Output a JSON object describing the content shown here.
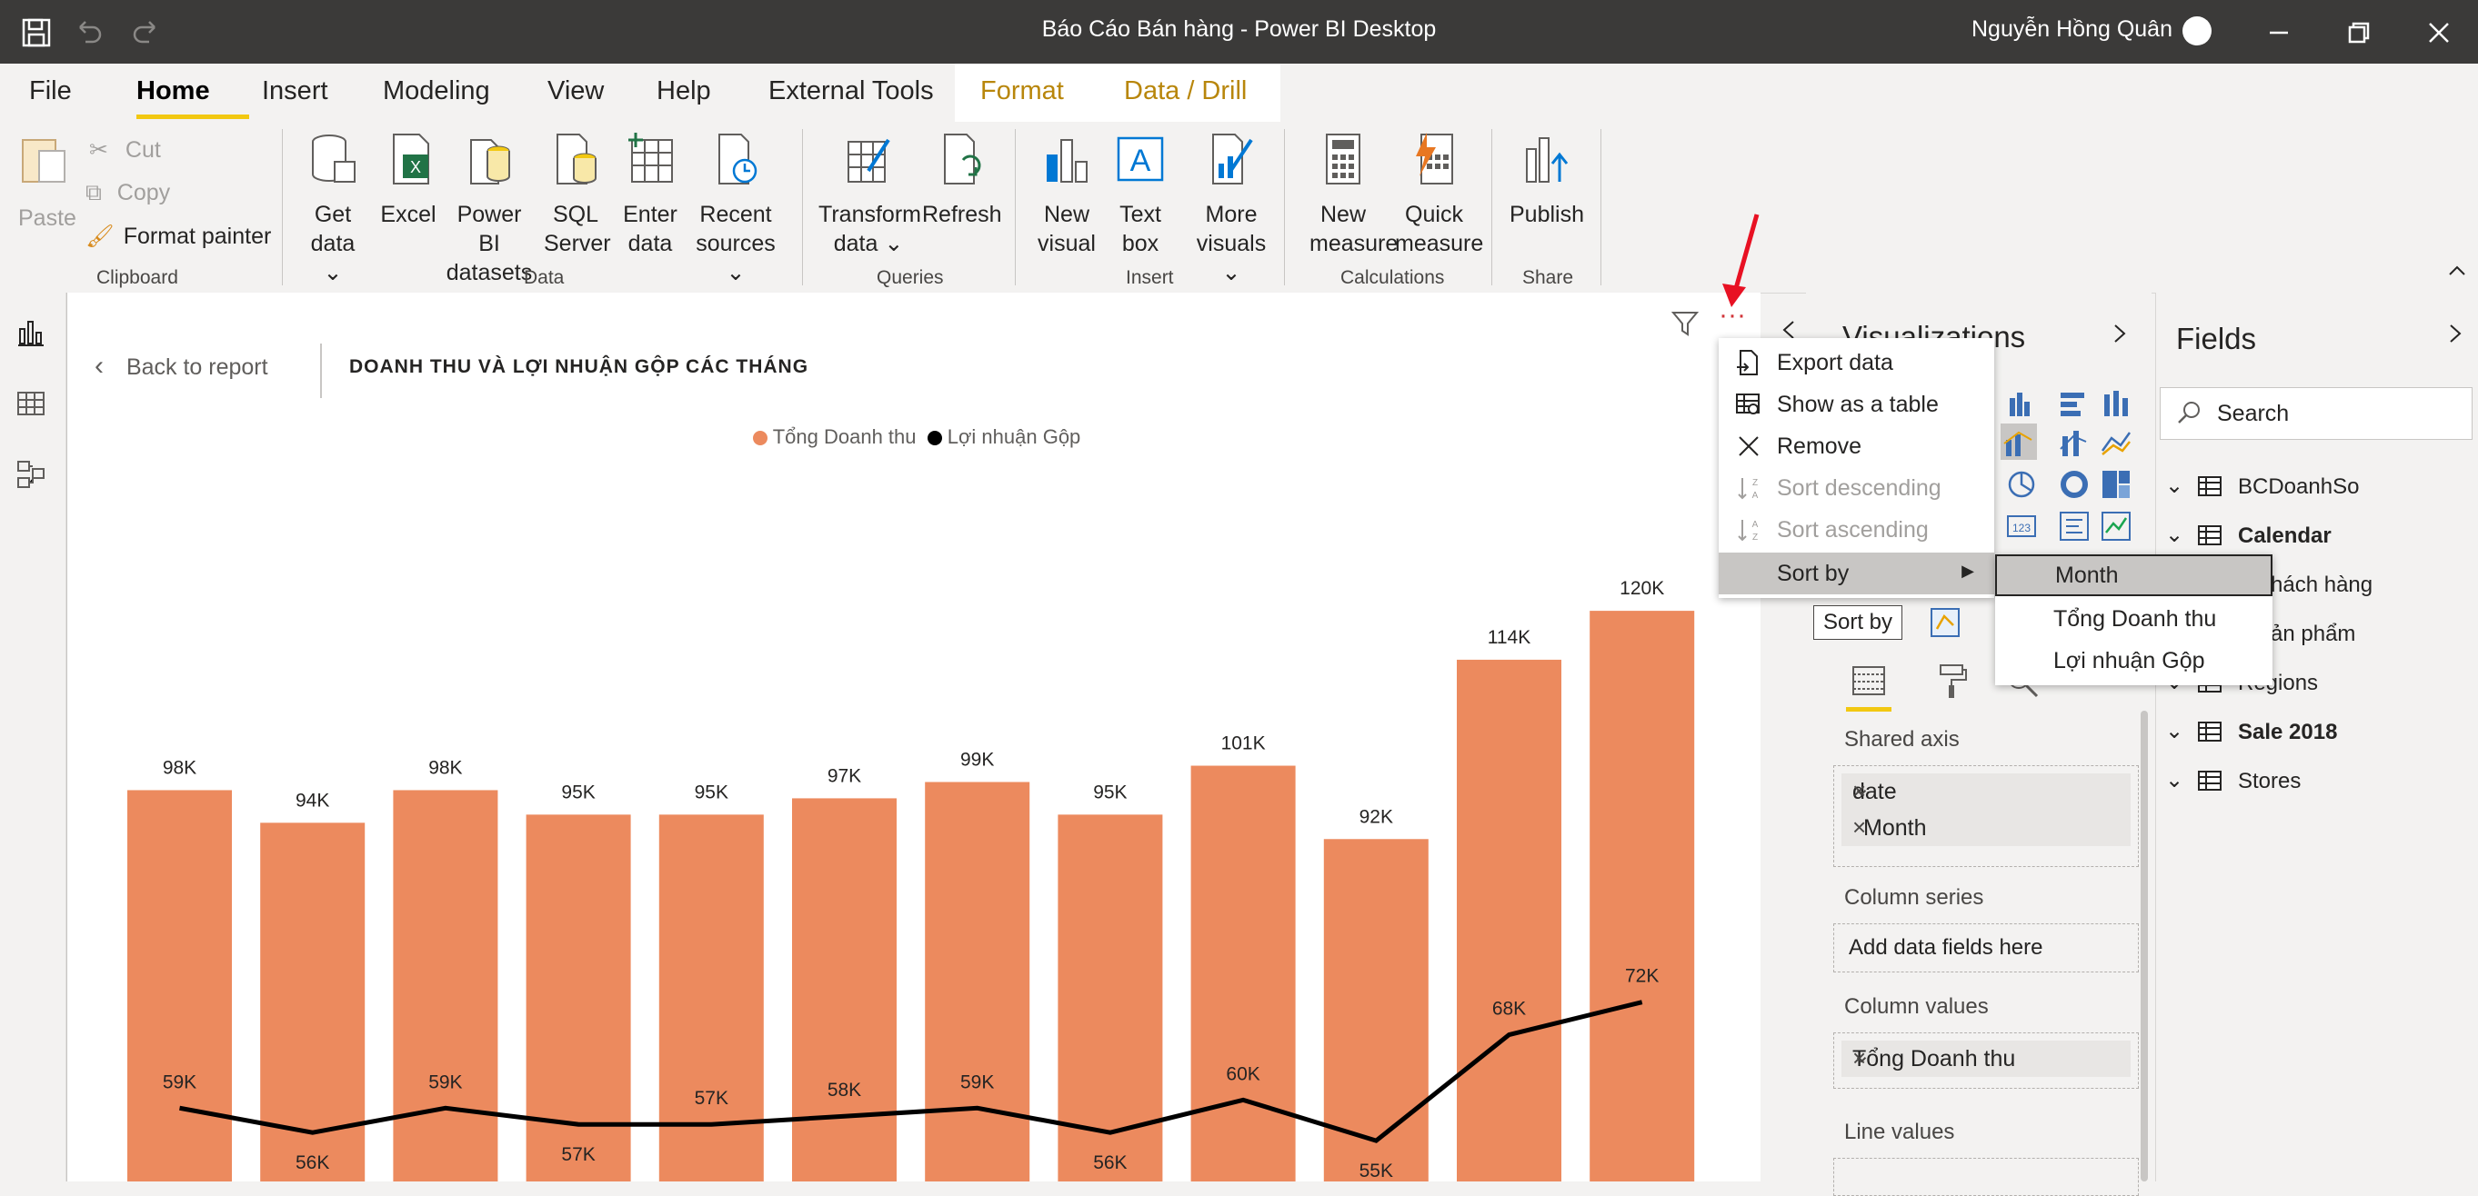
{
  "window": {
    "title": "Báo Cáo Bán hàng - Power BI Desktop",
    "user": "Nguyễn Hồng Quân"
  },
  "tabs": [
    "File",
    "Home",
    "Insert",
    "Modeling",
    "View",
    "Help",
    "External Tools"
  ],
  "contextual_tabs": [
    "Format",
    "Data / Drill"
  ],
  "ribbon": {
    "clipboard": {
      "paste": "Paste",
      "cut": "Cut",
      "copy": "Copy",
      "format_painter": "Format painter",
      "group": "Clipboard"
    },
    "data": {
      "get_data": [
        "Get",
        "data"
      ],
      "excel": "Excel",
      "pbi_datasets": [
        "Power BI",
        "datasets"
      ],
      "sql": [
        "SQL",
        "Server"
      ],
      "enter_data": [
        "Enter",
        "data"
      ],
      "recent": [
        "Recent",
        "sources"
      ],
      "group": "Data"
    },
    "queries": {
      "transform": [
        "Transform",
        "data"
      ],
      "refresh": "Refresh",
      "group": "Queries"
    },
    "insert": {
      "new_visual": [
        "New",
        "visual"
      ],
      "text_box": [
        "Text",
        "box"
      ],
      "more_visuals": [
        "More",
        "visuals"
      ],
      "group": "Insert"
    },
    "calculations": {
      "new_measure": [
        "New",
        "measure"
      ],
      "quick_measure": [
        "Quick",
        "measure"
      ],
      "group": "Calculations"
    },
    "share": {
      "publish": "Publish",
      "group": "Share"
    }
  },
  "focus": {
    "back": "Back to report",
    "title": "DOANH THU VÀ LỢI NHUẬN GỘP CÁC THÁNG"
  },
  "chart_data": {
    "type": "bar",
    "series": [
      {
        "name": "Tổng Doanh thu",
        "type": "bar",
        "color": "#ec8a5e",
        "values": [
          98,
          94,
          98,
          95,
          95,
          97,
          99,
          95,
          101,
          92,
          114,
          120
        ],
        "labels": [
          "98K",
          "94K",
          "98K",
          "95K",
          "95K",
          "97K",
          "99K",
          "95K",
          "101K",
          "92K",
          "114K",
          "120K"
        ]
      },
      {
        "name": "Lợi nhuận Gộp",
        "type": "line",
        "color": "#000000",
        "values": [
          59,
          56,
          59,
          57,
          57,
          58,
          59,
          56,
          60,
          55,
          68,
          72
        ],
        "labels": [
          "59K",
          "56K",
          "59K",
          "57K",
          "57K",
          "58K",
          "59K",
          "56K",
          "60K",
          "55K",
          "68K",
          "72K"
        ]
      }
    ]
  },
  "context_menu": {
    "items": [
      "Export data",
      "Show as a table",
      "Remove",
      "Sort descending",
      "Sort ascending",
      "Sort by"
    ],
    "submenu": [
      "Month",
      "Tổng Doanh thu",
      "Lợi nhuận Gộp"
    ],
    "tooltip": "Sort by"
  },
  "visualizations": {
    "title": "Visualizations",
    "wells": {
      "shared_axis": "Shared axis",
      "axis_fields": [
        "date",
        "Month"
      ],
      "column_series": "Column series",
      "column_series_placeholder": "Add data fields here",
      "column_values": "Column values",
      "column_value_field": "Tổng Doanh thu",
      "line_values": "Line values"
    }
  },
  "fields": {
    "title": "Fields",
    "search_placeholder": "Search",
    "tables": [
      {
        "name": "BCDoanhSo",
        "bold": false
      },
      {
        "name": "Calendar",
        "bold": true
      },
      {
        "name": "a Khách hàng",
        "bold": false
      },
      {
        "name": "a Sản phẩm",
        "bold": false
      },
      {
        "name": "Regions",
        "bold": false
      },
      {
        "name": "Sale 2018",
        "bold": true
      },
      {
        "name": "Stores",
        "bold": false
      }
    ]
  }
}
